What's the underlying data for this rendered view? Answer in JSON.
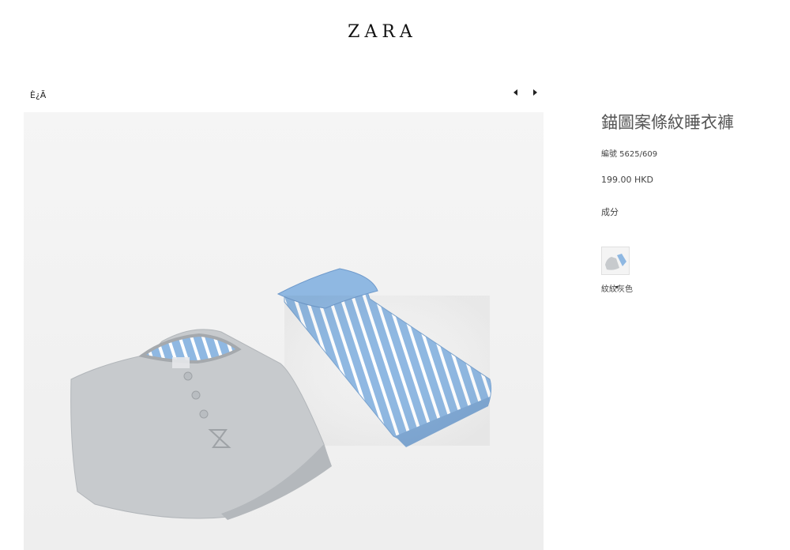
{
  "header": {
    "logo": "ZARA"
  },
  "breadcrumb": {
    "label": "È¿Ã"
  },
  "gallery": {
    "prev_icon": "caret-left-icon",
    "next_icon": "caret-right-icon"
  },
  "product": {
    "title": "錨圖案條紋睡衣褲",
    "reference": "編號 5625/609",
    "price": "199.00 HKD",
    "composition_label": "成分",
    "colors": [
      {
        "name": "紋紋灰色",
        "selected": true
      }
    ]
  },
  "palette": {
    "shirt_grey": "#c7cacd",
    "pants_blue": "#8fb8e2",
    "stripe_white": "#ffffff",
    "background": "#f2f2f2"
  }
}
